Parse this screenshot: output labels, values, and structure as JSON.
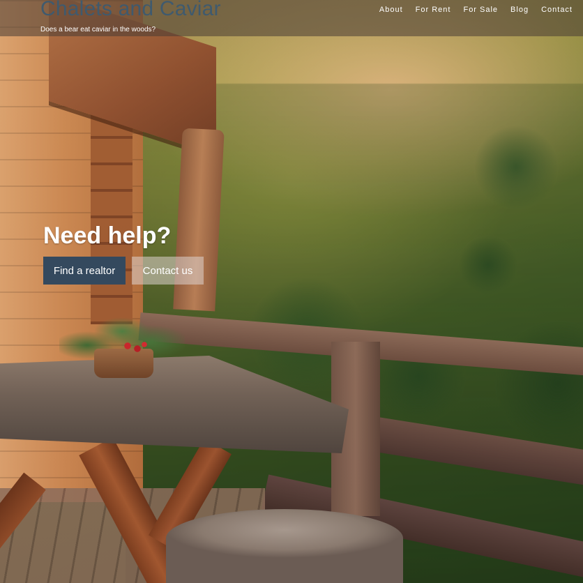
{
  "site": {
    "title": "Chalets and Caviar",
    "tagline": "Does a bear eat caviar in the woods?"
  },
  "nav": {
    "items": [
      {
        "label": "About"
      },
      {
        "label": "For Rent"
      },
      {
        "label": "For Sale"
      },
      {
        "label": "Blog"
      },
      {
        "label": "Contact"
      }
    ]
  },
  "hero": {
    "heading": "Need help?",
    "primary_button": "Find a realtor",
    "secondary_button": "Contact us",
    "image": "mountain-chalet-balcony-photo"
  },
  "colors": {
    "brand_title": "#3f5a6e",
    "primary_button": "#34495e",
    "topbar_overlay": "rgba(72,60,52,0.55)"
  }
}
